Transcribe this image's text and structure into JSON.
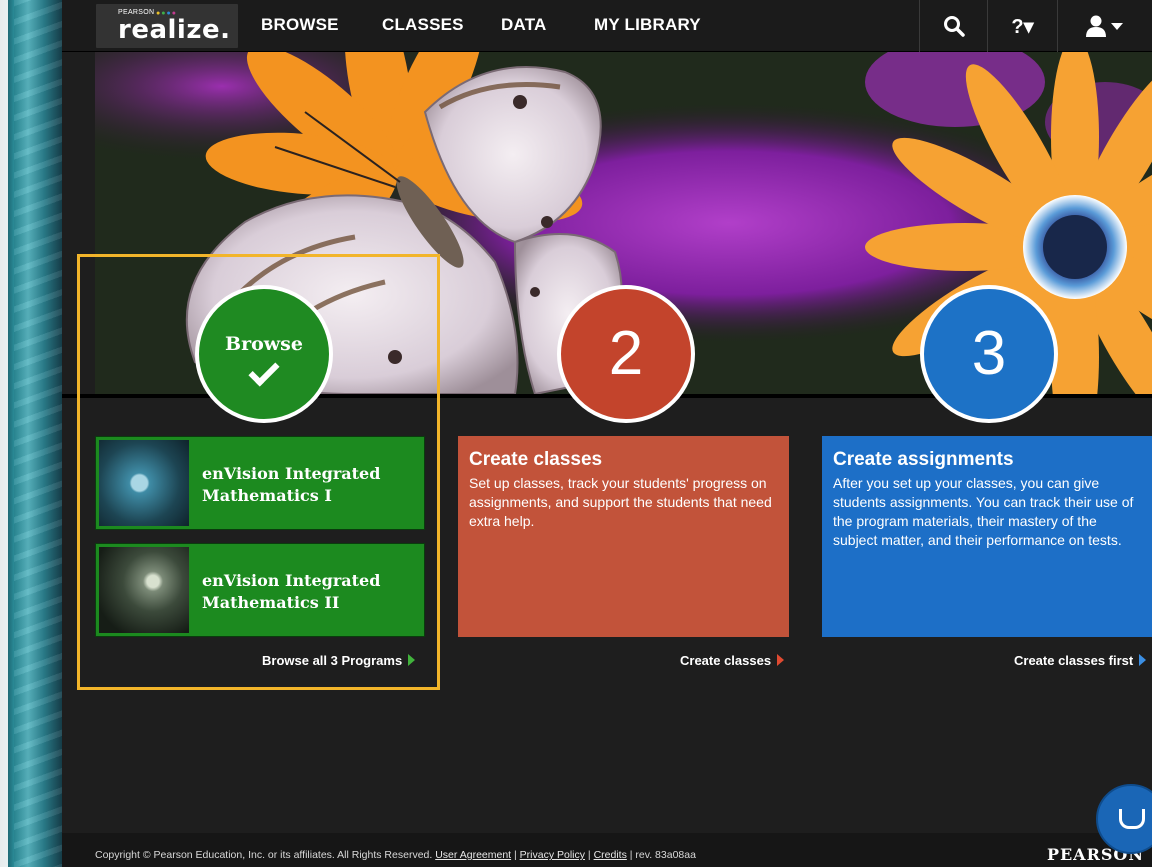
{
  "nav": {
    "logo_small": "PEARSON",
    "logo_word": "realize.",
    "links": [
      "BROWSE",
      "CLASSES",
      "DATA",
      "MY LIBRARY"
    ],
    "search_icon": "search-icon",
    "help_label": "?▾",
    "user_icon": "user-icon"
  },
  "steps": {
    "step1_label": "Browse",
    "step2_number": "2",
    "step3_number": "3"
  },
  "programs": [
    {
      "title": "enVision Integrated Mathematics I"
    },
    {
      "title": "enVision Integrated Mathematics II"
    }
  ],
  "browse_all_label": "Browse all 3 Programs",
  "cards": {
    "classes": {
      "title": "Create classes",
      "body": "Set up classes, track your students' progress on assignments, and support the students that need extra help.",
      "link": "Create classes"
    },
    "assignments": {
      "title": "Create assignments",
      "body": "After you set up your classes, you can give students assignments. You can track their use of the program materials, their mastery of the subject matter, and their performance on tests.",
      "link": "Create classes first"
    }
  },
  "colors": {
    "step1": "#1f8a22",
    "step2": "#c3442c",
    "step3": "#1d72c6",
    "highlight": "#f2b52a"
  },
  "footer": {
    "copyright": "Copyright © Pearson Education, Inc. or its affiliates. All Rights Reserved.",
    "user_agreement": "User Agreement",
    "privacy_policy": "Privacy Policy",
    "credits": "Credits",
    "rev": "rev. 83a08aa",
    "brand": "PEARSON"
  }
}
